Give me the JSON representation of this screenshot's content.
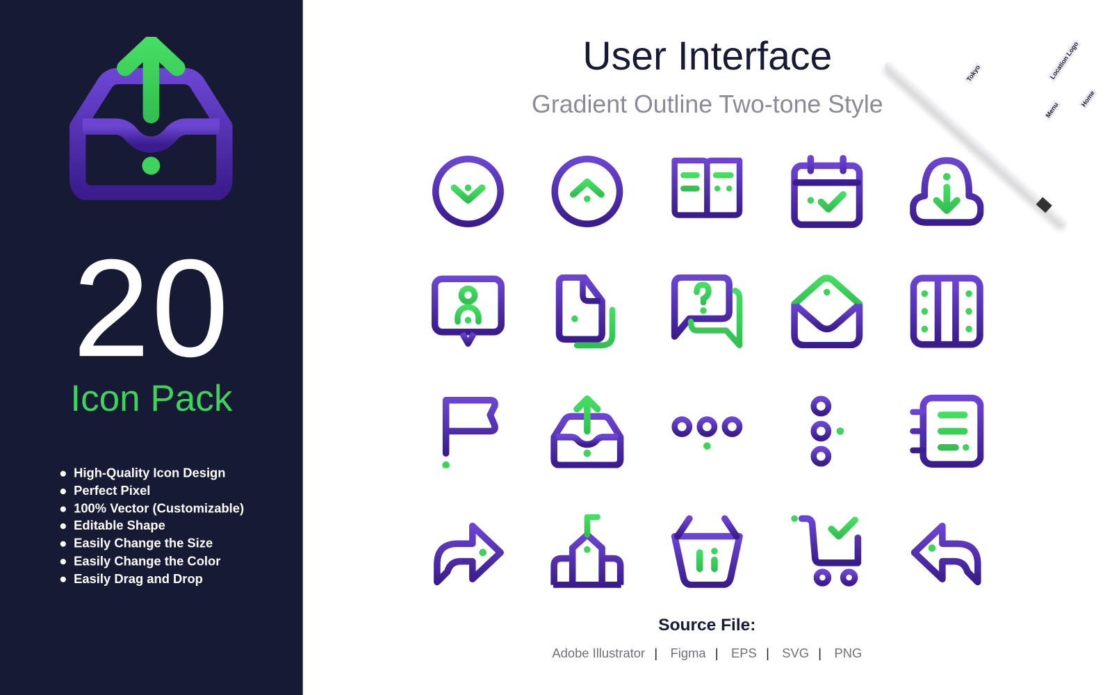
{
  "colors": {
    "panel": "#161a33",
    "accent_green": "#3fd35d",
    "purple_top": "#6b45d2",
    "purple_bottom": "#3a1c8c"
  },
  "hero": {
    "icon": "inbox-upload-icon",
    "count": "20",
    "label": "Icon Pack"
  },
  "features": [
    "High-Quality Icon Design",
    "Perfect Pixel",
    "100% Vector (Customizable)",
    "Editable Shape",
    "Easily Change the Size",
    "Easily Change the Color",
    "Easily Drag and Drop"
  ],
  "header": {
    "title": "User Interface",
    "subtitle": "Gradient Outline Two-tone Style"
  },
  "icons": [
    "circle-chevron-down-icon",
    "circle-chevron-up-icon",
    "open-book-icon",
    "calendar-check-icon",
    "cloud-download-icon",
    "presentation-user-icon",
    "file-copy-icon",
    "chat-question-icon",
    "open-envelope-icon",
    "columns-icon",
    "flag-icon",
    "inbox-upload-icon",
    "dots-horizontal-icon",
    "dots-vertical-icon",
    "notebook-list-icon",
    "forward-arrow-icon",
    "home-flag-icon",
    "basket-icon",
    "cart-check-icon",
    "reply-arrow-icon"
  ],
  "source": {
    "title": "Source File:",
    "formats": [
      "Adobe Illustrator",
      "Figma",
      "EPS",
      "SVG",
      "PNG"
    ]
  },
  "tablet_mockup": {
    "labels": [
      "Tokyo",
      "Location Logo",
      "Menu",
      "Home"
    ]
  }
}
